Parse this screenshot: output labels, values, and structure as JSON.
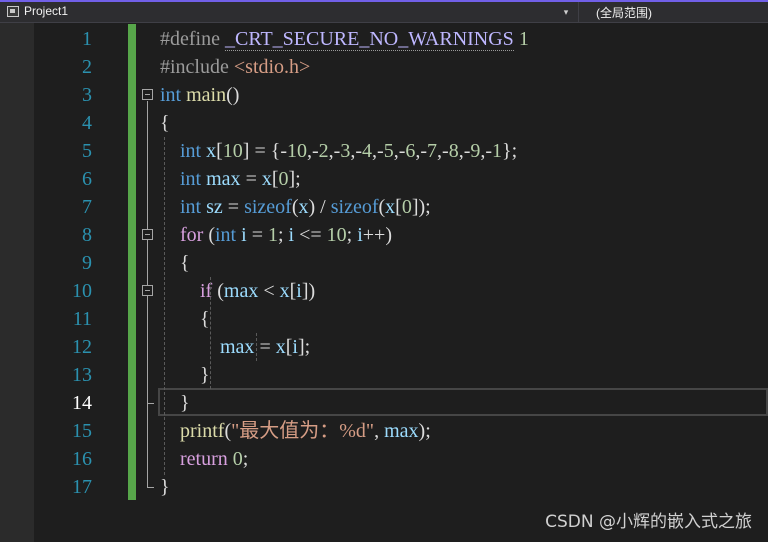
{
  "toolbar": {
    "project": "Project1",
    "scope": "(全局范围)"
  },
  "editor": {
    "current_line": 14,
    "line_numbers": [
      "1",
      "2",
      "3",
      "4",
      "5",
      "6",
      "7",
      "8",
      "9",
      "10",
      "11",
      "12",
      "13",
      "14",
      "15",
      "16",
      "17"
    ],
    "code_lines": [
      "#define _CRT_SECURE_NO_WARNINGS 1",
      "#include <stdio.h>",
      "int main()",
      "{",
      "    int x[10] = {-10,-2,-3,-4,-5,-6,-7,-8,-9,-1};",
      "    int max = x[0];",
      "    int sz = sizeof(x) / sizeof(x[0]);",
      "    for (int i = 1; i <= 10; i++)",
      "    {",
      "        if (max < x[i])",
      "        {",
      "            max = x[i];",
      "        }",
      "    }",
      "    printf(\"最大值为：%d\", max);",
      "    return 0;",
      "}"
    ]
  },
  "watermark": "CSDN @小辉的嵌入式之旅"
}
